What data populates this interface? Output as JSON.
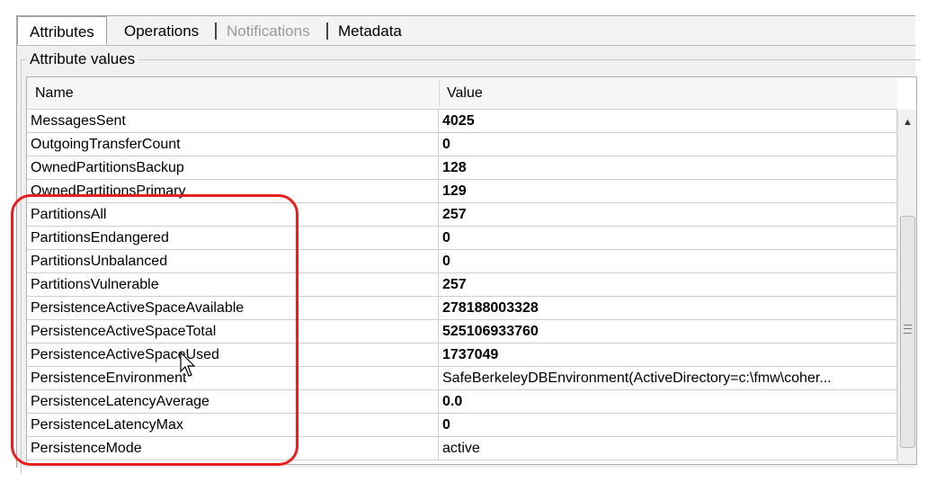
{
  "tabs": [
    {
      "label": "Attributes",
      "state": "active"
    },
    {
      "label": "Operations",
      "state": "normal"
    },
    {
      "label": "Notifications",
      "state": "disabled"
    },
    {
      "label": "Metadata",
      "state": "normal"
    }
  ],
  "group_title": "Attribute values",
  "table": {
    "columns": [
      "Name",
      "Value"
    ],
    "rows": [
      {
        "name": "MessagesSent",
        "value": "4025"
      },
      {
        "name": "OutgoingTransferCount",
        "value": "0"
      },
      {
        "name": "OwnedPartitionsBackup",
        "value": "128"
      },
      {
        "name": "OwnedPartitionsPrimary",
        "value": "129"
      },
      {
        "name": "PartitionsAll",
        "value": "257"
      },
      {
        "name": "PartitionsEndangered",
        "value": "0"
      },
      {
        "name": "PartitionsUnbalanced",
        "value": "0"
      },
      {
        "name": "PartitionsVulnerable",
        "value": "257"
      },
      {
        "name": "PersistenceActiveSpaceAvailable",
        "value": "278188003328"
      },
      {
        "name": "PersistenceActiveSpaceTotal",
        "value": "525106933760"
      },
      {
        "name": "PersistenceActiveSpaceUsed",
        "value": "1737049"
      },
      {
        "name": "PersistenceEnvironment",
        "value": "SafeBerkeleyDBEnvironment(ActiveDirectory=c:\\fmw\\coher..."
      },
      {
        "name": "PersistenceLatencyAverage",
        "value": "0.0"
      },
      {
        "name": "PersistenceLatencyMax",
        "value": "0"
      },
      {
        "name": "PersistenceMode",
        "value": "active"
      }
    ]
  },
  "colors": {
    "highlight": "#e52020",
    "disabled_text": "#9a9a9a"
  },
  "icons": {
    "scroll_up": "chevron-up-icon",
    "cursor": "mouse-pointer-icon"
  }
}
